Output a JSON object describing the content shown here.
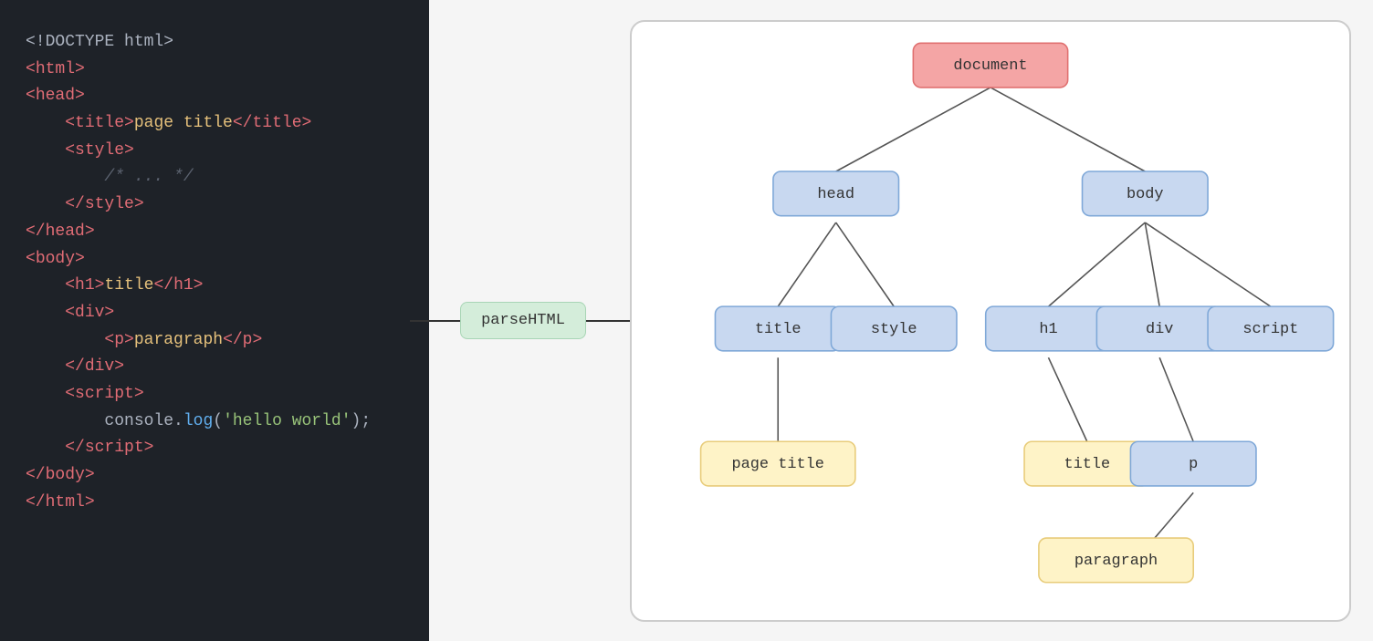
{
  "code": {
    "lines": [
      {
        "parts": [
          {
            "text": "<!DOCTYPE html>",
            "cls": "c-doctype"
          }
        ]
      },
      {
        "parts": [
          {
            "text": "<",
            "cls": "c-bracket"
          },
          {
            "text": "html",
            "cls": "c-tag"
          },
          {
            "text": ">",
            "cls": "c-bracket"
          }
        ]
      },
      {
        "parts": [
          {
            "text": "<",
            "cls": "c-bracket"
          },
          {
            "text": "head",
            "cls": "c-tag"
          },
          {
            "text": ">",
            "cls": "c-bracket"
          }
        ]
      },
      {
        "parts": [
          {
            "text": "    <",
            "cls": "c-bracket"
          },
          {
            "text": "title",
            "cls": "c-tag"
          },
          {
            "text": ">",
            "cls": "c-bracket"
          },
          {
            "text": "page title",
            "cls": "c-content"
          },
          {
            "text": "</",
            "cls": "c-bracket"
          },
          {
            "text": "title",
            "cls": "c-tag"
          },
          {
            "text": ">",
            "cls": "c-bracket"
          }
        ]
      },
      {
        "parts": [
          {
            "text": "    <",
            "cls": "c-bracket"
          },
          {
            "text": "style",
            "cls": "c-tag"
          },
          {
            "text": ">",
            "cls": "c-bracket"
          }
        ]
      },
      {
        "parts": [
          {
            "text": "        ",
            "cls": "c-text"
          },
          {
            "text": "/* ... */",
            "cls": "c-comment"
          }
        ]
      },
      {
        "parts": [
          {
            "text": "    </",
            "cls": "c-bracket"
          },
          {
            "text": "style",
            "cls": "c-tag"
          },
          {
            "text": ">",
            "cls": "c-bracket"
          }
        ]
      },
      {
        "parts": [
          {
            "text": "</",
            "cls": "c-bracket"
          },
          {
            "text": "head",
            "cls": "c-tag"
          },
          {
            "text": ">",
            "cls": "c-bracket"
          }
        ]
      },
      {
        "parts": [
          {
            "text": "<",
            "cls": "c-bracket"
          },
          {
            "text": "body",
            "cls": "c-tag"
          },
          {
            "text": ">",
            "cls": "c-bracket"
          }
        ]
      },
      {
        "parts": [
          {
            "text": "    <",
            "cls": "c-bracket"
          },
          {
            "text": "h1",
            "cls": "c-tag"
          },
          {
            "text": ">",
            "cls": "c-bracket"
          },
          {
            "text": "title",
            "cls": "c-content"
          },
          {
            "text": "</",
            "cls": "c-bracket"
          },
          {
            "text": "h1",
            "cls": "c-tag"
          },
          {
            "text": ">",
            "cls": "c-bracket"
          }
        ]
      },
      {
        "parts": [
          {
            "text": "    <",
            "cls": "c-bracket"
          },
          {
            "text": "div",
            "cls": "c-tag"
          },
          {
            "text": ">",
            "cls": "c-bracket"
          }
        ]
      },
      {
        "parts": [
          {
            "text": "        <",
            "cls": "c-bracket"
          },
          {
            "text": "p",
            "cls": "c-tag"
          },
          {
            "text": ">",
            "cls": "c-bracket"
          },
          {
            "text": "paragraph",
            "cls": "c-content"
          },
          {
            "text": "</",
            "cls": "c-bracket"
          },
          {
            "text": "p",
            "cls": "c-tag"
          },
          {
            "text": ">",
            "cls": "c-bracket"
          }
        ]
      },
      {
        "parts": [
          {
            "text": "    </",
            "cls": "c-bracket"
          },
          {
            "text": "div",
            "cls": "c-tag"
          },
          {
            "text": ">",
            "cls": "c-bracket"
          }
        ]
      },
      {
        "parts": [
          {
            "text": "    <",
            "cls": "c-bracket"
          },
          {
            "text": "script",
            "cls": "c-tag"
          },
          {
            "text": ">",
            "cls": "c-bracket"
          }
        ]
      },
      {
        "parts": [
          {
            "text": "        ",
            "cls": "c-text"
          },
          {
            "text": "console",
            "cls": "c-prop"
          },
          {
            "text": ".",
            "cls": "c-text"
          },
          {
            "text": "log",
            "cls": "c-method"
          },
          {
            "text": "(",
            "cls": "c-text"
          },
          {
            "text": "'hello world'",
            "cls": "c-string"
          },
          {
            "text": ");",
            "cls": "c-text"
          }
        ]
      },
      {
        "parts": [
          {
            "text": "    </",
            "cls": "c-bracket"
          },
          {
            "text": "script",
            "cls": "c-tag"
          },
          {
            "text": ">",
            "cls": "c-bracket"
          }
        ]
      },
      {
        "parts": [
          {
            "text": "</",
            "cls": "c-bracket"
          },
          {
            "text": "body",
            "cls": "c-tag"
          },
          {
            "text": ">",
            "cls": "c-bracket"
          }
        ]
      },
      {
        "parts": [
          {
            "text": "</",
            "cls": "c-bracket"
          },
          {
            "text": "html",
            "cls": "c-tag"
          },
          {
            "text": ">",
            "cls": "c-bracket"
          }
        ]
      }
    ]
  },
  "arrow": {
    "label": "parseHTML"
  },
  "tree": {
    "nodes": {
      "document": "document",
      "head": "head",
      "body": "body",
      "title": "title",
      "style": "style",
      "h1": "h1",
      "div": "div",
      "script": "script",
      "page_title": "page title",
      "title2": "title",
      "p": "p",
      "paragraph": "paragraph"
    }
  }
}
